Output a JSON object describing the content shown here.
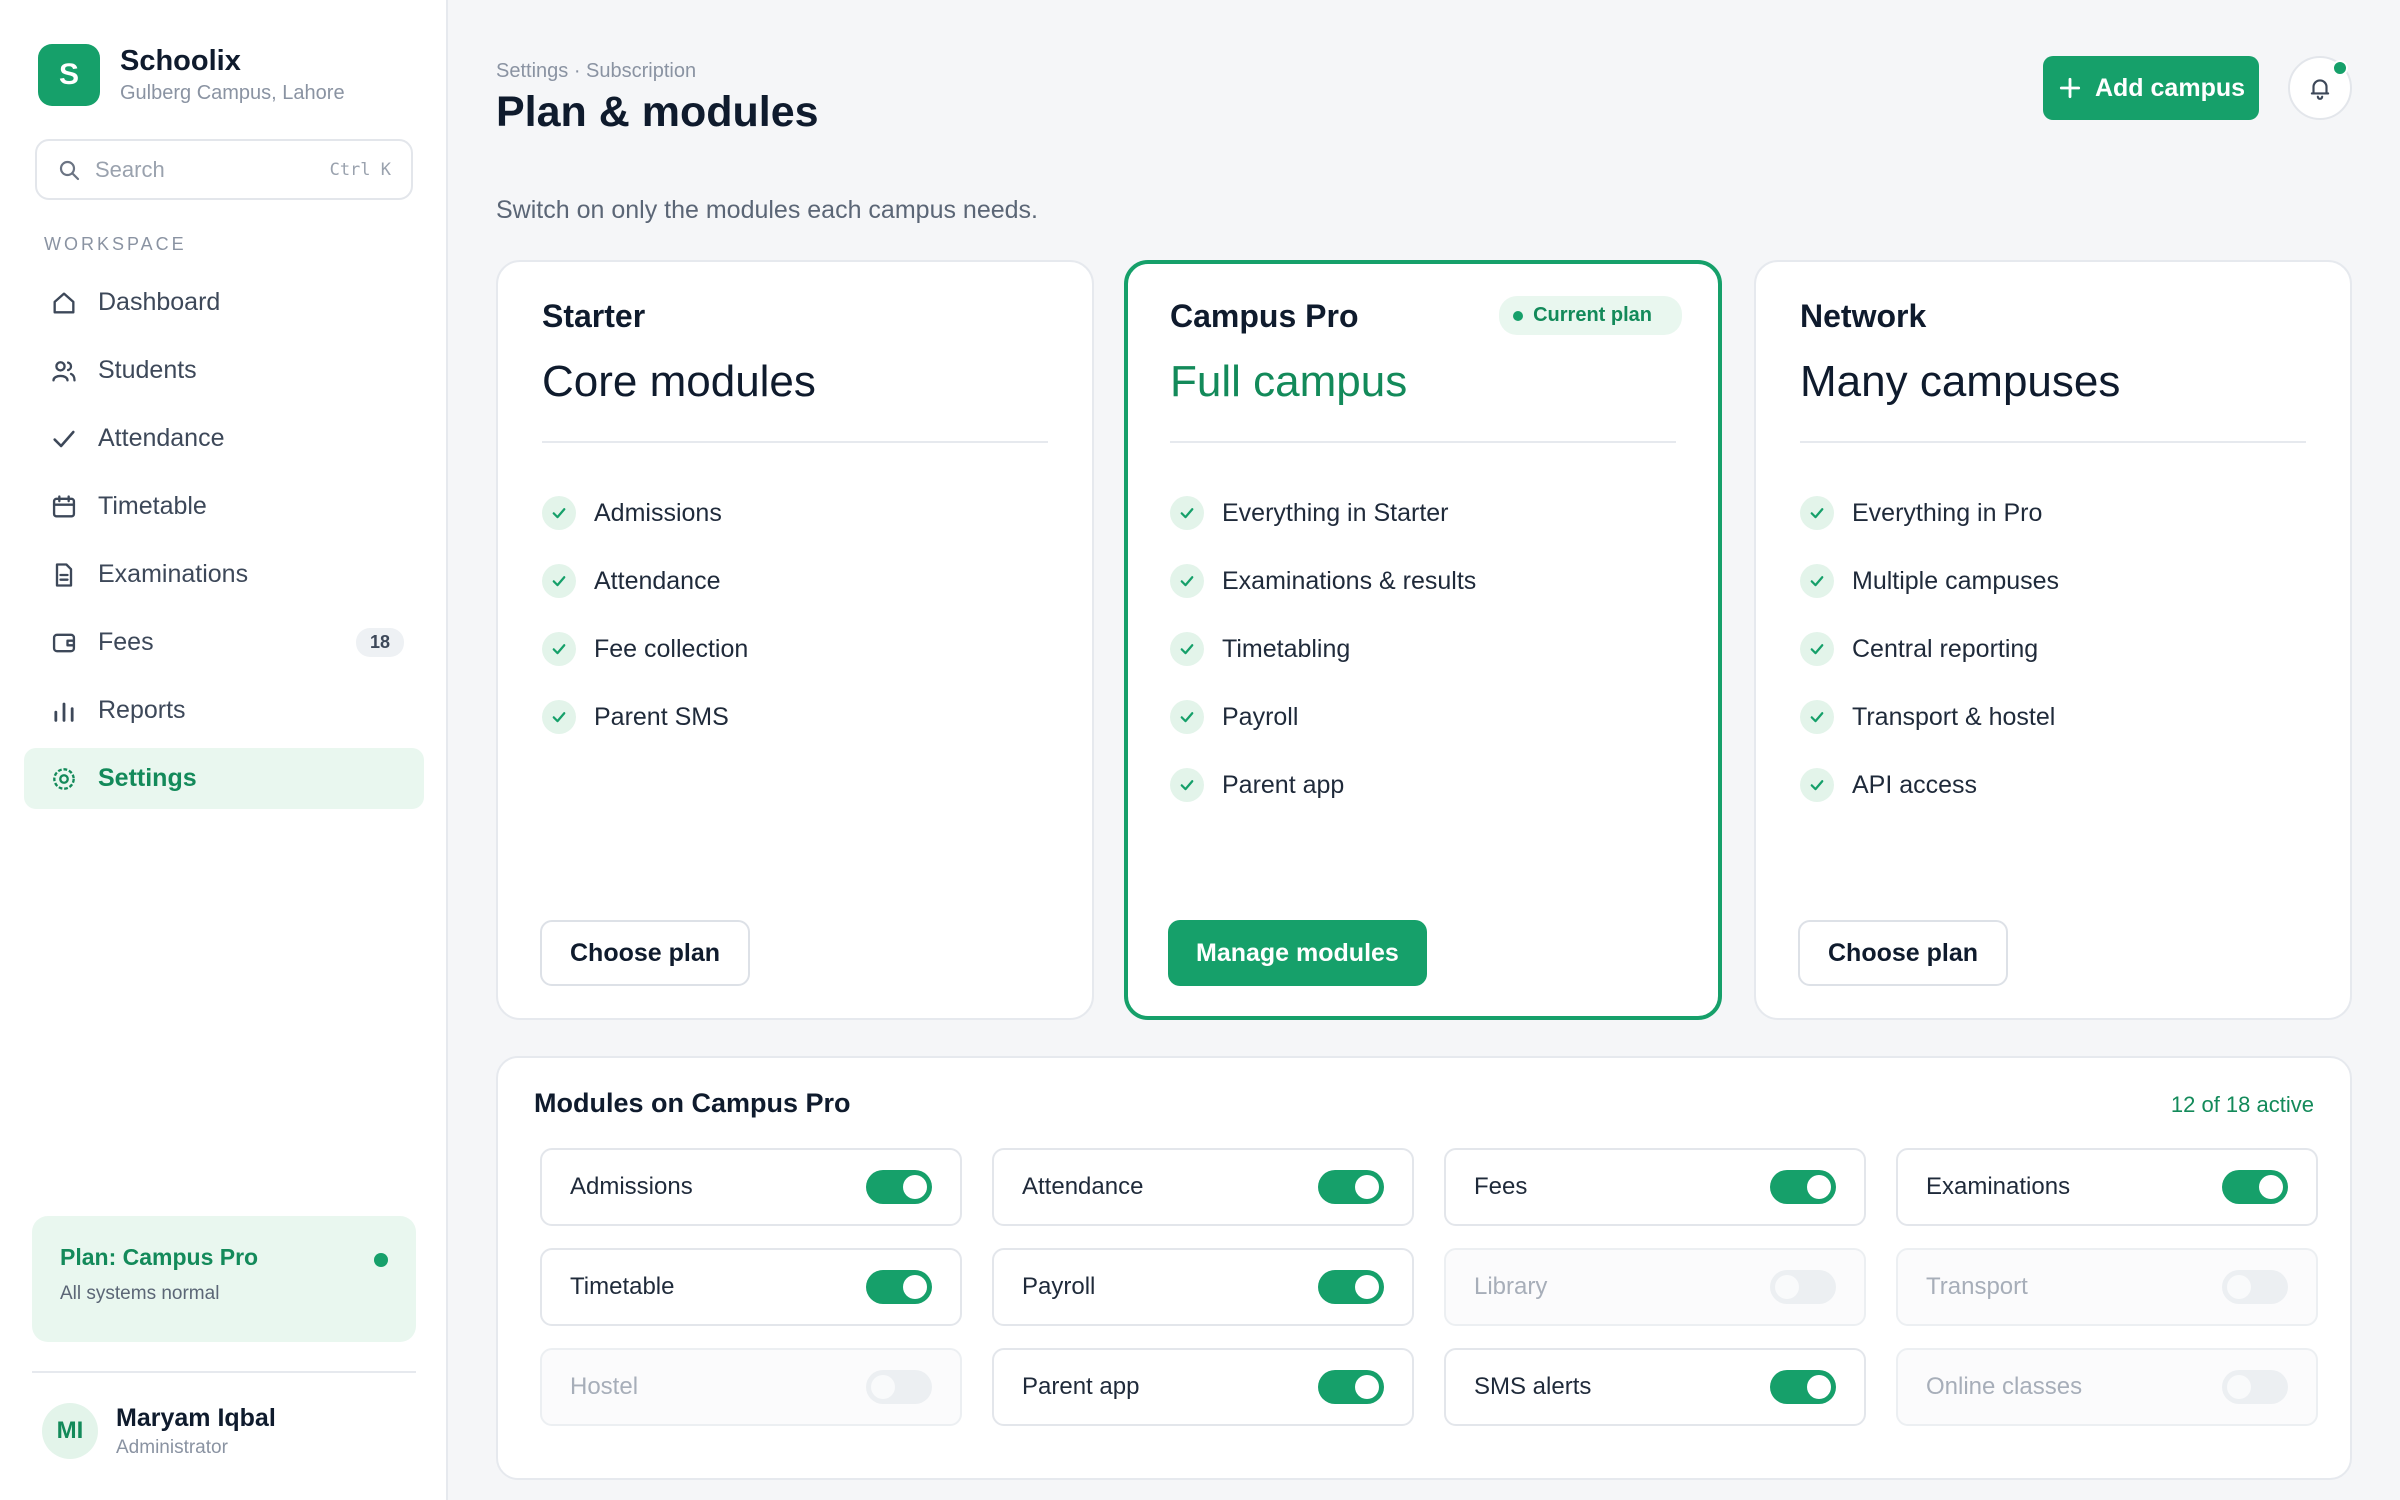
{
  "brand": {
    "initial": "S",
    "name": "Schoolix",
    "campus": "Gulberg Campus, Lahore"
  },
  "search": {
    "placeholder": "Search",
    "shortcut": "Ctrl K"
  },
  "sidebar": {
    "section_label": "WORKSPACE",
    "items": [
      {
        "label": "Dashboard",
        "icon": "home-icon"
      },
      {
        "label": "Students",
        "icon": "users-icon"
      },
      {
        "label": "Attendance",
        "icon": "check-icon"
      },
      {
        "label": "Timetable",
        "icon": "calendar-icon"
      },
      {
        "label": "Examinations",
        "icon": "document-icon"
      },
      {
        "label": "Fees",
        "icon": "wallet-icon",
        "badge": "18"
      },
      {
        "label": "Reports",
        "icon": "bar-chart-icon"
      },
      {
        "label": "Settings",
        "icon": "gear-icon",
        "active": true
      }
    ],
    "plan": {
      "title": "Plan: Campus Pro",
      "status": "All systems normal"
    },
    "user": {
      "initials": "MI",
      "name": "Maryam Iqbal",
      "role": "Administrator"
    }
  },
  "header": {
    "breadcrumb": "Settings · Subscription",
    "title": "Plan & modules",
    "add_label": "Add campus",
    "subtitle": "Switch on only the modules each campus needs."
  },
  "plans": [
    {
      "name": "Starter",
      "headline": "Core modules",
      "features": [
        "Admissions",
        "Attendance",
        "Fee collection",
        "Parent SMS"
      ],
      "button": "Choose plan"
    },
    {
      "name": "Campus Pro",
      "headline": "Full campus",
      "badge": "Current plan",
      "features": [
        "Everything in Starter",
        "Examinations & results",
        "Timetabling",
        "Payroll",
        "Parent app"
      ],
      "button": "Manage modules"
    },
    {
      "name": "Network",
      "headline": "Many campuses",
      "features": [
        "Everything in Pro",
        "Multiple campuses",
        "Central reporting",
        "Transport & hostel",
        "API access"
      ],
      "button": "Choose plan"
    }
  ],
  "modules": {
    "title": "Modules on Campus Pro",
    "count": "12 of 18 active",
    "items": [
      {
        "label": "Admissions",
        "on": true
      },
      {
        "label": "Attendance",
        "on": true
      },
      {
        "label": "Fees",
        "on": true
      },
      {
        "label": "Examinations",
        "on": true
      },
      {
        "label": "Timetable",
        "on": true
      },
      {
        "label": "Payroll",
        "on": true
      },
      {
        "label": "Library",
        "on": false
      },
      {
        "label": "Transport",
        "on": false
      },
      {
        "label": "Hostel",
        "on": false
      },
      {
        "label": "Parent app",
        "on": true
      },
      {
        "label": "SMS alerts",
        "on": true
      },
      {
        "label": "Online classes",
        "on": false
      }
    ]
  },
  "colors": {
    "accent": "#16a06a",
    "accent_dark": "#138a5a",
    "accent_soft": "#e9f7ef"
  }
}
